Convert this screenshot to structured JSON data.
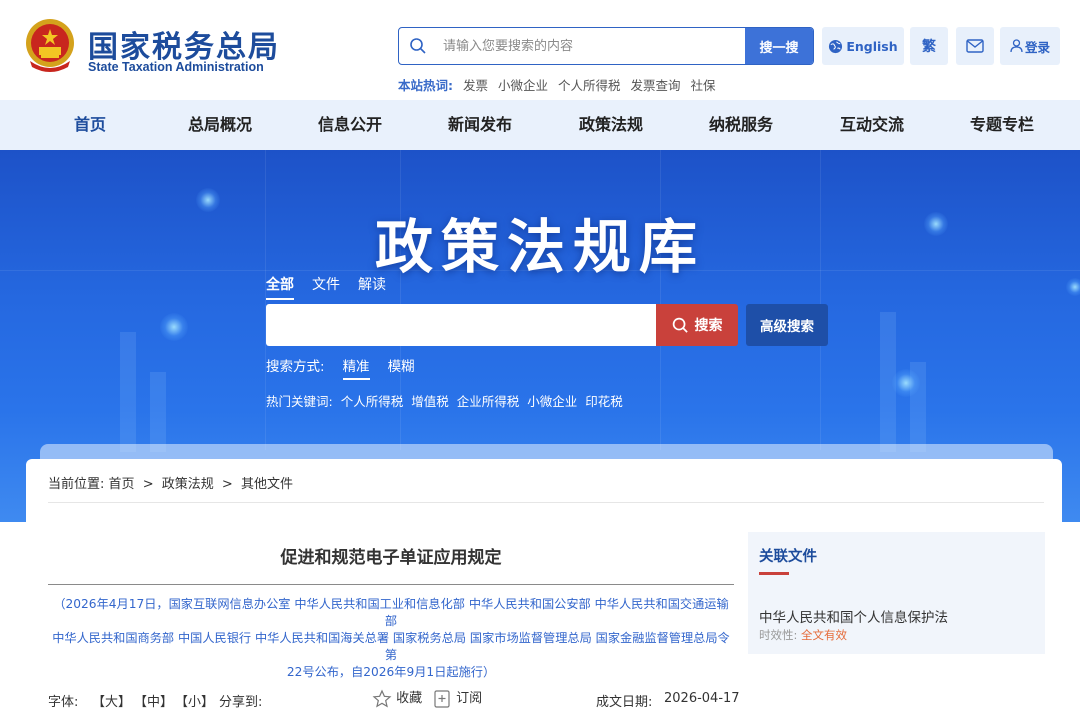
{
  "header": {
    "site_name_cn": "国家税务总局",
    "site_name_en": "State Taxation Administration",
    "search": {
      "placeholder": "请输入您要搜索的内容",
      "button_label": "搜一搜"
    },
    "hot_label": "本站热词:",
    "hot_words": [
      "发票",
      "小微企业",
      "个人所得税",
      "发票查询",
      "社保"
    ],
    "english_label": "English",
    "traditional_label": "繁",
    "login_label": "登录"
  },
  "nav": {
    "items": [
      "首页",
      "总局概况",
      "信息公开",
      "新闻发布",
      "政策法规",
      "纳税服务",
      "互动交流",
      "专题专栏"
    ],
    "active_index": 0
  },
  "banner": {
    "title": "政策法规库",
    "tabs": [
      "全部",
      "文件",
      "解读"
    ],
    "active_tab": 0,
    "search_value": "",
    "search_button": "搜索",
    "advanced_button": "高级搜索",
    "mode_label": "搜索方式:",
    "modes": [
      "精准",
      "模糊"
    ],
    "active_mode": 0,
    "hot_label": "热门关键词:",
    "hot_keywords": [
      "个人所得税",
      "增值税",
      "企业所得税",
      "小微企业",
      "印花税"
    ]
  },
  "breadcrumb": {
    "label": "当前位置:",
    "items": [
      "首页",
      "政策法规",
      "其他文件"
    ],
    "separator": ">"
  },
  "document": {
    "title": "促进和规范电子单证应用规定",
    "info_lines": [
      "（2026年4月17日，国家互联网信息办公室 中华人民共和国工业和信息化部 中华人民共和国公安部 中华人民共和国交通运输部",
      "中华人民共和国商务部 中国人民银行 中华人民共和国海关总署 国家税务总局 国家市场监督管理总局 国家金融监督管理总局令第",
      "22号公布，自2026年9月1日起施行）"
    ],
    "font_label": "字体:",
    "font_sizes": [
      "【大】",
      "【中】",
      "【小】"
    ],
    "share_label": "分享到:",
    "favorite_label": "收藏",
    "subscribe_label": "订阅",
    "date_label": "成文日期:",
    "date_value": "2026-04-17"
  },
  "sidebar": {
    "title": "关联文件",
    "items": [
      {
        "title": "中华人民共和国个人信息保护法",
        "status_label": "时效性:",
        "status_value": "全文有效"
      }
    ]
  },
  "colors": {
    "brand_blue": "#1d4c9c",
    "accent_blue": "#3d72d8",
    "nav_bg": "#e9f1fc",
    "search_red": "#c9413b",
    "status_orange": "#e56b3a"
  }
}
